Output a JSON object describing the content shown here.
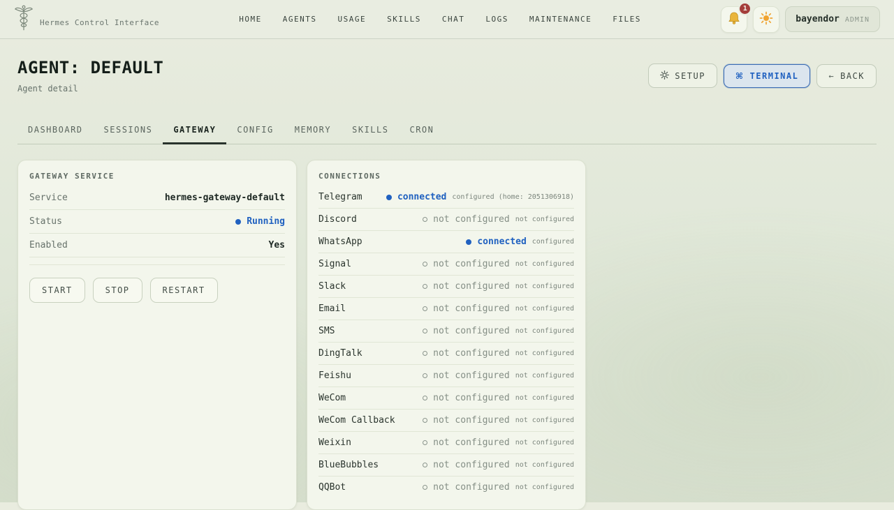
{
  "topbar": {
    "brand": "Hermes Control Interface",
    "nav": [
      "HOME",
      "AGENTS",
      "USAGE",
      "SKILLS",
      "CHAT",
      "LOGS",
      "MAINTENANCE",
      "FILES"
    ],
    "notification_badge": "1",
    "user": {
      "name": "bayendor",
      "role": "ADMIN"
    }
  },
  "header": {
    "title": "AGENT: DEFAULT",
    "subtitle": "Agent detail",
    "actions": {
      "setup": "SETUP",
      "terminal": "TERMINAL",
      "back": "BACK"
    },
    "icons": {
      "terminal": "⌘",
      "back_arrow": "←"
    }
  },
  "tabs": [
    {
      "label": "DASHBOARD",
      "active": false
    },
    {
      "label": "SESSIONS",
      "active": false
    },
    {
      "label": "GATEWAY",
      "active": true
    },
    {
      "label": "CONFIG",
      "active": false
    },
    {
      "label": "MEMORY",
      "active": false
    },
    {
      "label": "SKILLS",
      "active": false
    },
    {
      "label": "CRON",
      "active": false
    }
  ],
  "gateway_card": {
    "title": "GATEWAY SERVICE",
    "rows": [
      {
        "label": "Service",
        "value": "hermes-gateway-default",
        "style": "bold"
      },
      {
        "label": "Status",
        "value": "Running",
        "style": "status"
      },
      {
        "label": "Enabled",
        "value": "Yes",
        "style": "bold"
      }
    ],
    "buttons": [
      "START",
      "STOP",
      "RESTART"
    ]
  },
  "connections_card": {
    "title": "CONNECTIONS",
    "rows": [
      {
        "name": "Telegram",
        "status": "connected",
        "connected": true,
        "detail": "configured (home: 2051306918)"
      },
      {
        "name": "Discord",
        "status": "not configured",
        "connected": false,
        "detail": "not configured"
      },
      {
        "name": "WhatsApp",
        "status": "connected",
        "connected": true,
        "detail": "configured"
      },
      {
        "name": "Signal",
        "status": "not configured",
        "connected": false,
        "detail": "not configured"
      },
      {
        "name": "Slack",
        "status": "not configured",
        "connected": false,
        "detail": "not configured"
      },
      {
        "name": "Email",
        "status": "not configured",
        "connected": false,
        "detail": "not configured"
      },
      {
        "name": "SMS",
        "status": "not configured",
        "connected": false,
        "detail": "not configured"
      },
      {
        "name": "DingTalk",
        "status": "not configured",
        "connected": false,
        "detail": "not configured"
      },
      {
        "name": "Feishu",
        "status": "not configured",
        "connected": false,
        "detail": "not configured"
      },
      {
        "name": "WeCom",
        "status": "not configured",
        "connected": false,
        "detail": "not configured"
      },
      {
        "name": "WeCom Callback",
        "status": "not configured",
        "connected": false,
        "detail": "not configured"
      },
      {
        "name": "Weixin",
        "status": "not configured",
        "connected": false,
        "detail": "not configured"
      },
      {
        "name": "BlueBubbles",
        "status": "not configured",
        "connected": false,
        "detail": "not configured"
      },
      {
        "name": "QQBot",
        "status": "not configured",
        "connected": false,
        "detail": "not configured"
      }
    ]
  },
  "colors": {
    "accent_blue": "#2061c0",
    "badge_red": "#a43d3a",
    "text_dark": "#1d2823",
    "text_muted": "#67726b",
    "card_bg": "#f3f6ec",
    "page_bg": "#e1e8d9"
  }
}
